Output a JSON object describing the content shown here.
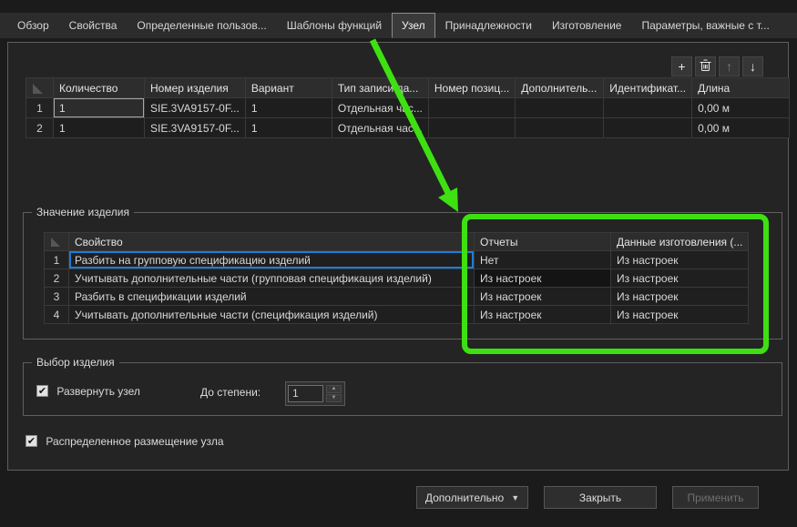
{
  "colors": {
    "highlight_green": "#3ee012",
    "selection_blue": "#1d7dd8"
  },
  "tabs": [
    {
      "label": "Обзор",
      "selected": false
    },
    {
      "label": "Свойства",
      "selected": false
    },
    {
      "label": "Определенные пользов...",
      "selected": false
    },
    {
      "label": "Шаблоны функций",
      "selected": false
    },
    {
      "label": "Узел",
      "selected": true
    },
    {
      "label": "Принадлежности",
      "selected": false
    },
    {
      "label": "Изготовление",
      "selected": false
    },
    {
      "label": "Параметры, важные с т...",
      "selected": false
    }
  ],
  "icons": {
    "add": "+",
    "up": "↑",
    "down": "↓",
    "dropdown": "▼",
    "check": "✔",
    "spin_up": "▲",
    "spin_down": "▼"
  },
  "parts_table": {
    "columns": [
      "Количество",
      "Номер изделия",
      "Вариант",
      "Тип записи да...",
      "Номер позиц...",
      "Дополнитель...",
      "Идентификат...",
      "Длина"
    ],
    "rows": [
      {
        "num": "1",
        "quantity": "1",
        "part_number": "SIE.3VA9157-0F...",
        "variant": "1",
        "record_type": "Отдельная час...",
        "position": "",
        "additional": "",
        "identifier": "",
        "length": "0,00 м"
      },
      {
        "num": "2",
        "quantity": "1",
        "part_number": "SIE.3VA9157-0F...",
        "variant": "1",
        "record_type": "Отдельная час...",
        "position": "",
        "additional": "",
        "identifier": "",
        "length": "0,00 м"
      }
    ]
  },
  "product_value": {
    "title": "Значение изделия",
    "columns": [
      "Свойство",
      "Отчеты",
      "Данные изготовления (..."
    ],
    "rows": [
      {
        "num": "1",
        "property": "Разбить на групповую спецификацию изделий",
        "reports": "Нет",
        "manufacturing": "Из настроек"
      },
      {
        "num": "2",
        "property": "Учитывать дополнительные части (групповая спецификация изделий)",
        "reports": "Из настроек",
        "manufacturing": "Из настроек"
      },
      {
        "num": "3",
        "property": "Разбить в спецификации изделий",
        "reports": "Из настроек",
        "manufacturing": "Из настроек"
      },
      {
        "num": "4",
        "property": "Учитывать дополнительные части (спецификация изделий)",
        "reports": "Из настроек",
        "manufacturing": "Из настроек"
      }
    ]
  },
  "product_selection": {
    "title": "Выбор изделия",
    "expand_label": "Развернуть узел",
    "depth_label": "До степени:",
    "depth_value": "1"
  },
  "distributed_label": "Распределенное размещение узла",
  "footer": {
    "more_label": "Дополнительно",
    "close_label": "Закрыть",
    "apply_label": "Применить"
  }
}
